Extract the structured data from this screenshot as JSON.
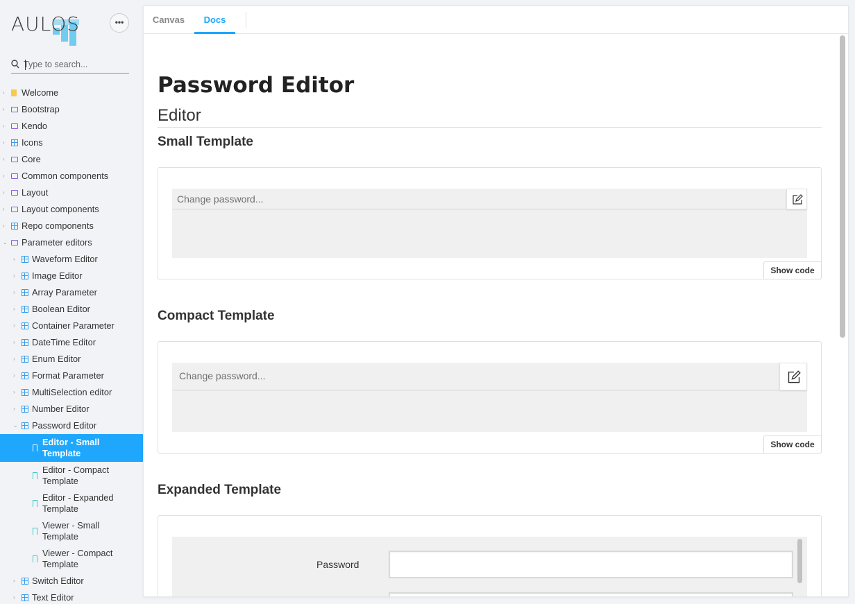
{
  "app": {
    "logo_text": "AULOS",
    "more_icon": "ellipsis-icon"
  },
  "search": {
    "placeholder": "Type to search...",
    "icon": "search-icon"
  },
  "sidebar": {
    "items": [
      {
        "label": "Welcome",
        "icon": "document-icon"
      },
      {
        "label": "Bootstrap",
        "icon": "folder-icon"
      },
      {
        "label": "Kendo",
        "icon": "folder-icon"
      },
      {
        "label": "Icons",
        "icon": "component-icon"
      },
      {
        "label": "Core",
        "icon": "folder-icon"
      },
      {
        "label": "Common components",
        "icon": "folder-icon"
      },
      {
        "label": "Layout",
        "icon": "folder-icon"
      },
      {
        "label": "Layout components",
        "icon": "folder-icon"
      },
      {
        "label": "Repo components",
        "icon": "component-icon"
      },
      {
        "label": "Parameter editors",
        "icon": "folder-icon"
      },
      {
        "label": "Waveform Editor",
        "icon": "component-icon"
      },
      {
        "label": "Image Editor",
        "icon": "component-icon"
      },
      {
        "label": "Array Parameter",
        "icon": "component-icon"
      },
      {
        "label": "Boolean Editor",
        "icon": "component-icon"
      },
      {
        "label": "Container Parameter",
        "icon": "component-icon"
      },
      {
        "label": "DateTime Editor",
        "icon": "component-icon"
      },
      {
        "label": "Enum Editor",
        "icon": "component-icon"
      },
      {
        "label": "Format Parameter",
        "icon": "component-icon"
      },
      {
        "label": "MultiSelection editor",
        "icon": "component-icon"
      },
      {
        "label": "Number Editor",
        "icon": "component-icon"
      },
      {
        "label": "Password Editor",
        "icon": "component-icon"
      },
      {
        "label": "Editor - Small Template",
        "icon": "bookmark-icon"
      },
      {
        "label": "Editor - Compact Template",
        "icon": "bookmark-icon"
      },
      {
        "label": "Editor - Expanded Template",
        "icon": "bookmark-icon"
      },
      {
        "label": "Viewer - Small Template",
        "icon": "bookmark-icon"
      },
      {
        "label": "Viewer - Compact Template",
        "icon": "bookmark-icon"
      },
      {
        "label": "Switch Editor",
        "icon": "component-icon"
      },
      {
        "label": "Text Editor",
        "icon": "component-icon"
      }
    ]
  },
  "tabs": [
    {
      "label": "Canvas"
    },
    {
      "label": "Docs"
    }
  ],
  "doc": {
    "title": "Password Editor",
    "section": "Editor",
    "small": {
      "heading": "Small Template",
      "placeholder": "Change password...",
      "show_code": "Show code"
    },
    "compact": {
      "heading": "Compact Template",
      "placeholder": "Change password...",
      "show_code": "Show code"
    },
    "expanded": {
      "heading": "Expanded Template",
      "password_label": "Password"
    }
  },
  "colors": {
    "accent": "#1ea7fd",
    "sidebar_bg": "#f1f3f6",
    "folder": "#8b5fd8",
    "component": "#3a9ee8",
    "story": "#3dc8c8",
    "document": "#f8c94d"
  }
}
